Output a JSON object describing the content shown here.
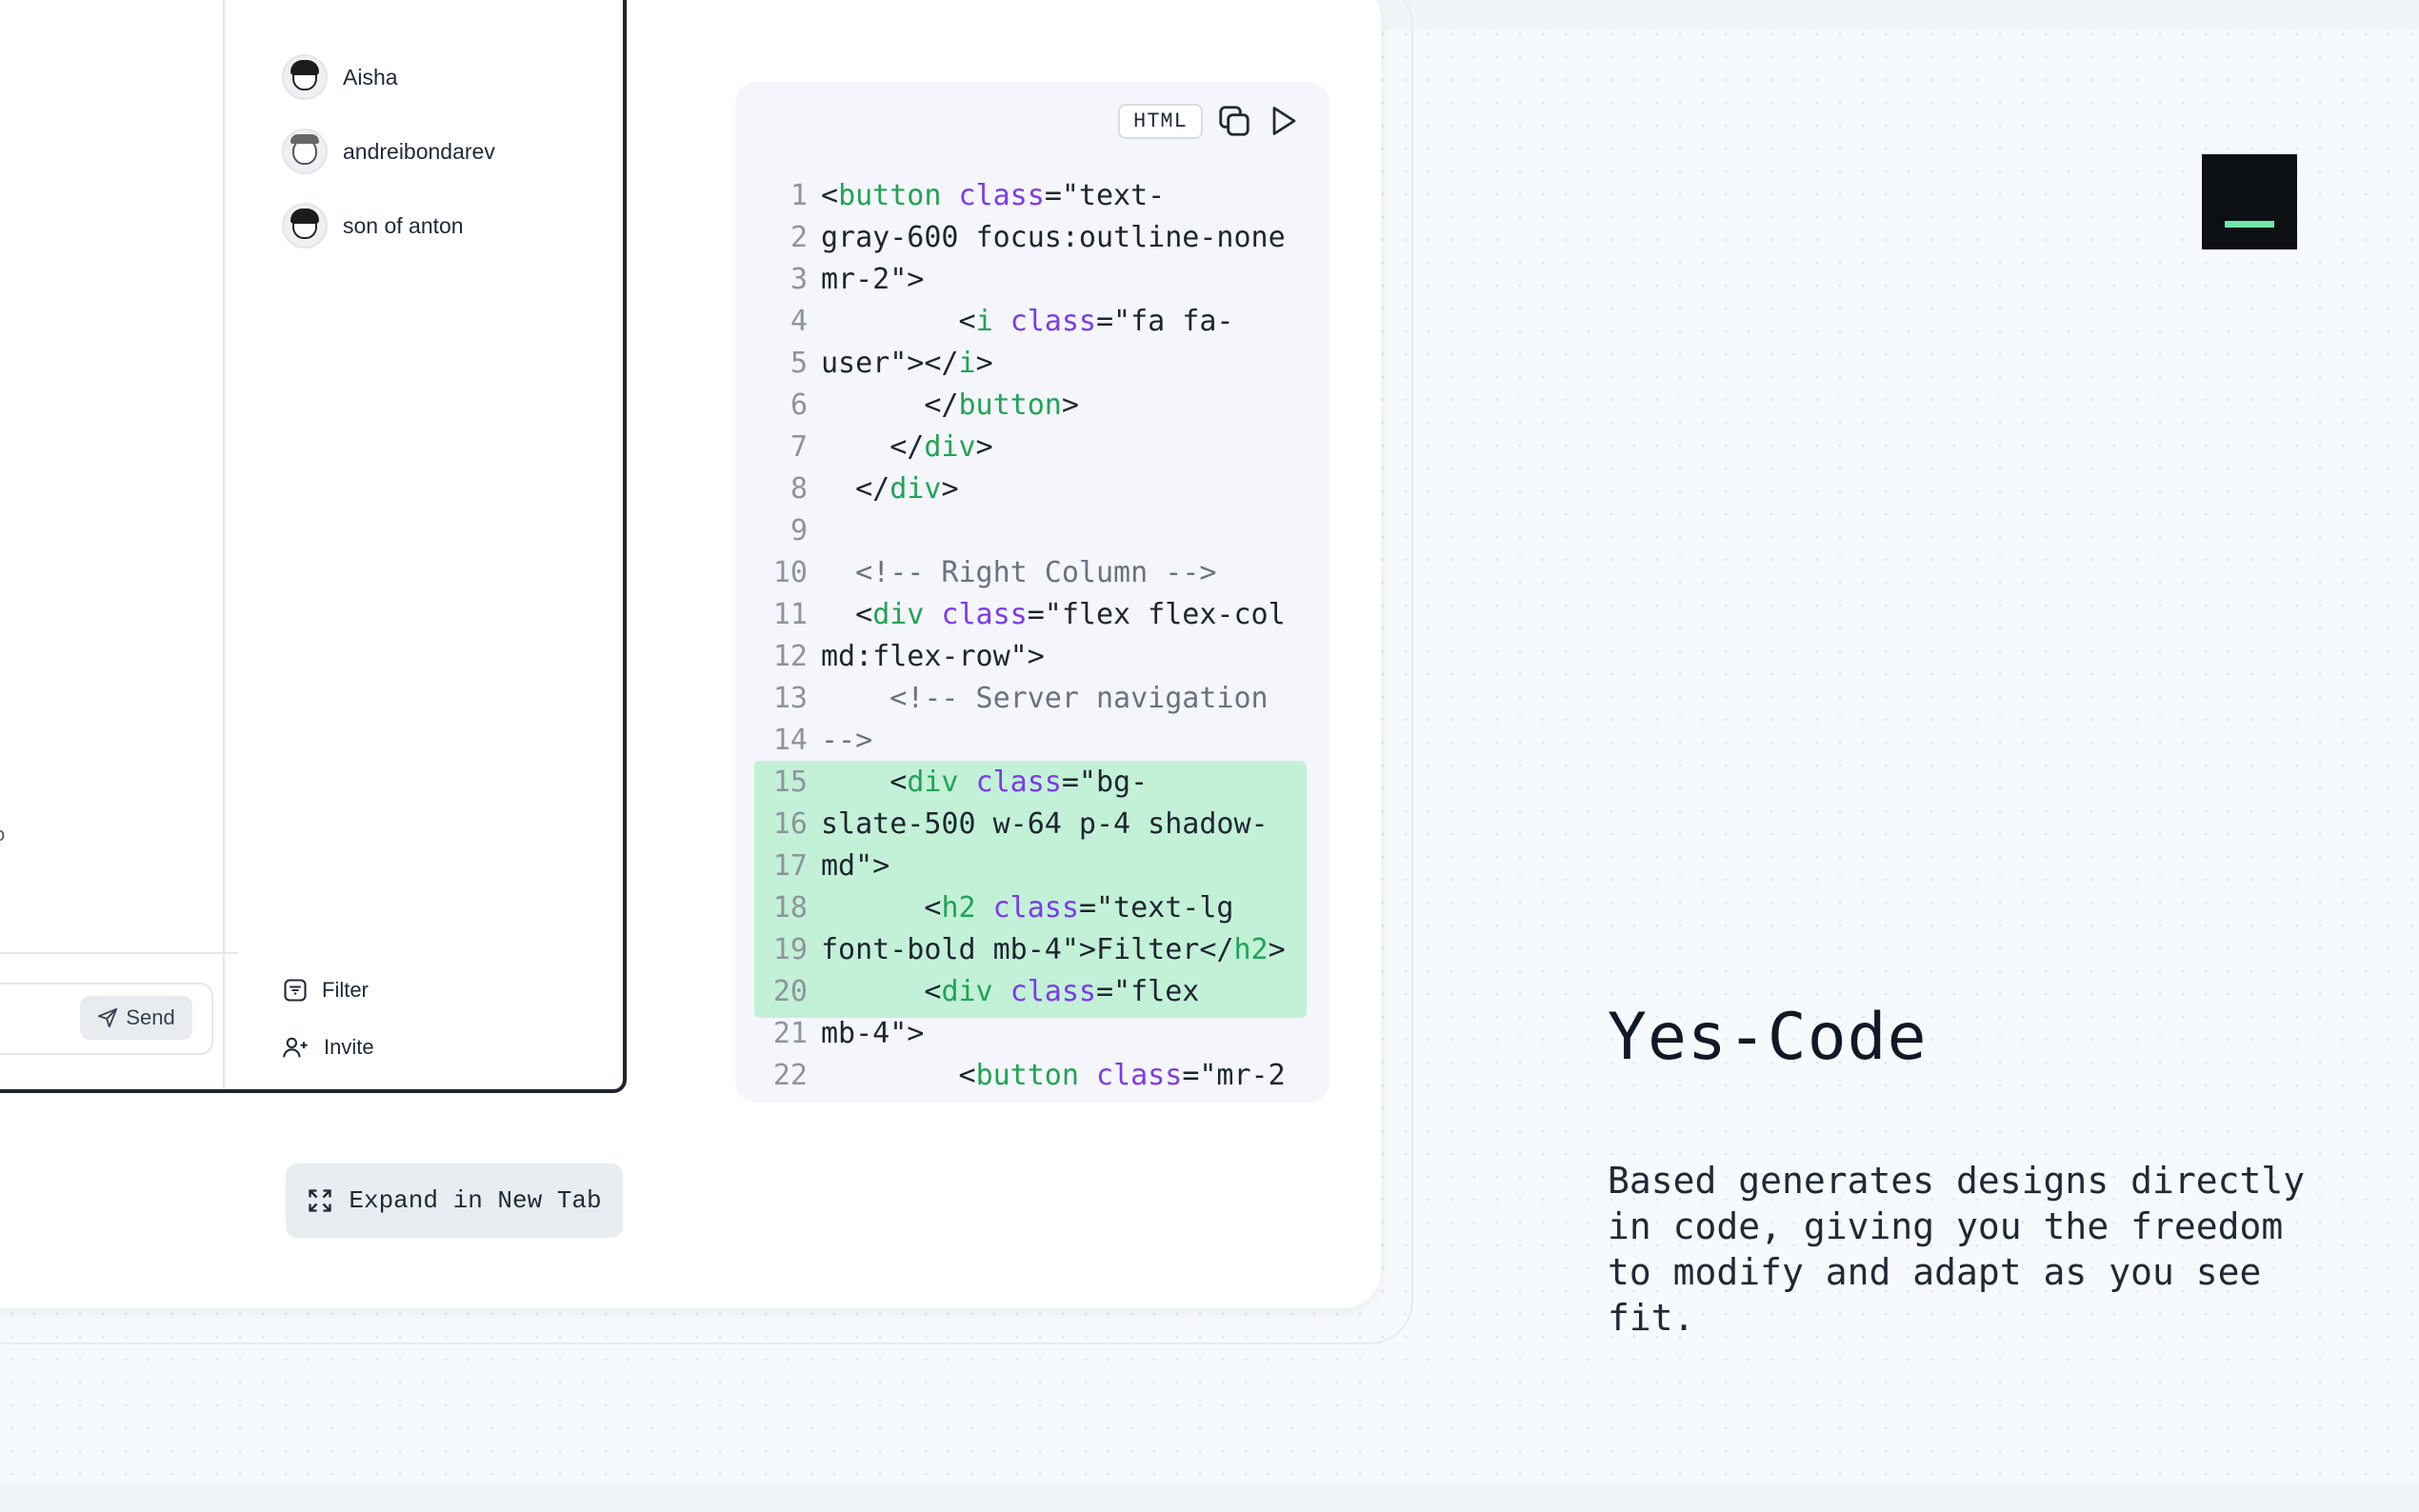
{
  "app": {
    "users": [
      {
        "name": "Aisha"
      },
      {
        "name": "andreibondarev"
      },
      {
        "name": "son of anton"
      }
    ],
    "sidebar_actions": {
      "filter": "Filter",
      "invite": "Invite"
    },
    "send_label": "Send",
    "stray_text": "o"
  },
  "expand_button": {
    "label": "Expand in New Tab"
  },
  "code_panel": {
    "language": "HTML",
    "highlight_lines": [
      15,
      16,
      17,
      18,
      19,
      20
    ],
    "lines": [
      {
        "n": "1",
        "text": "<button class=\"text-"
      },
      {
        "n": "2",
        "text": "gray-600 focus:outline-none"
      },
      {
        "n": "3",
        "text": "mr-2\">"
      },
      {
        "n": "4",
        "text": "        <i class=\"fa fa-"
      },
      {
        "n": "5",
        "text": "user\"></i>"
      },
      {
        "n": "6",
        "text": "      </button>"
      },
      {
        "n": "7",
        "text": "    </div>"
      },
      {
        "n": "8",
        "text": "  </div>"
      },
      {
        "n": "9",
        "text": ""
      },
      {
        "n": "10",
        "text": "  <!-- Right Column -->"
      },
      {
        "n": "11",
        "text": "  <div class=\"flex flex-col"
      },
      {
        "n": "12",
        "text": "md:flex-row\">"
      },
      {
        "n": "13",
        "text": "    <!-- Server navigation"
      },
      {
        "n": "14",
        "text": "-->"
      },
      {
        "n": "15",
        "text": "    <div class=\"bg-"
      },
      {
        "n": "16",
        "text": "slate-500 w-64 p-4 shadow-"
      },
      {
        "n": "17",
        "text": "md\">"
      },
      {
        "n": "18",
        "text": "      <h2 class=\"text-lg"
      },
      {
        "n": "19",
        "text": "font-bold mb-4\">Filter</h2>"
      },
      {
        "n": "20",
        "text": "      <div class=\"flex"
      },
      {
        "n": "21",
        "text": "mb-4\">"
      },
      {
        "n": "22",
        "text": "        <button class=\"mr-2"
      }
    ]
  },
  "feature": {
    "title": "Yes-Code",
    "description": "Based generates designs directly in code, giving you the freedom to modify and adapt as you see fit."
  },
  "colors": {
    "highlight": "#c2f1d8",
    "logo_accent": "#6ee7a8",
    "window_border": "#1e2530"
  }
}
